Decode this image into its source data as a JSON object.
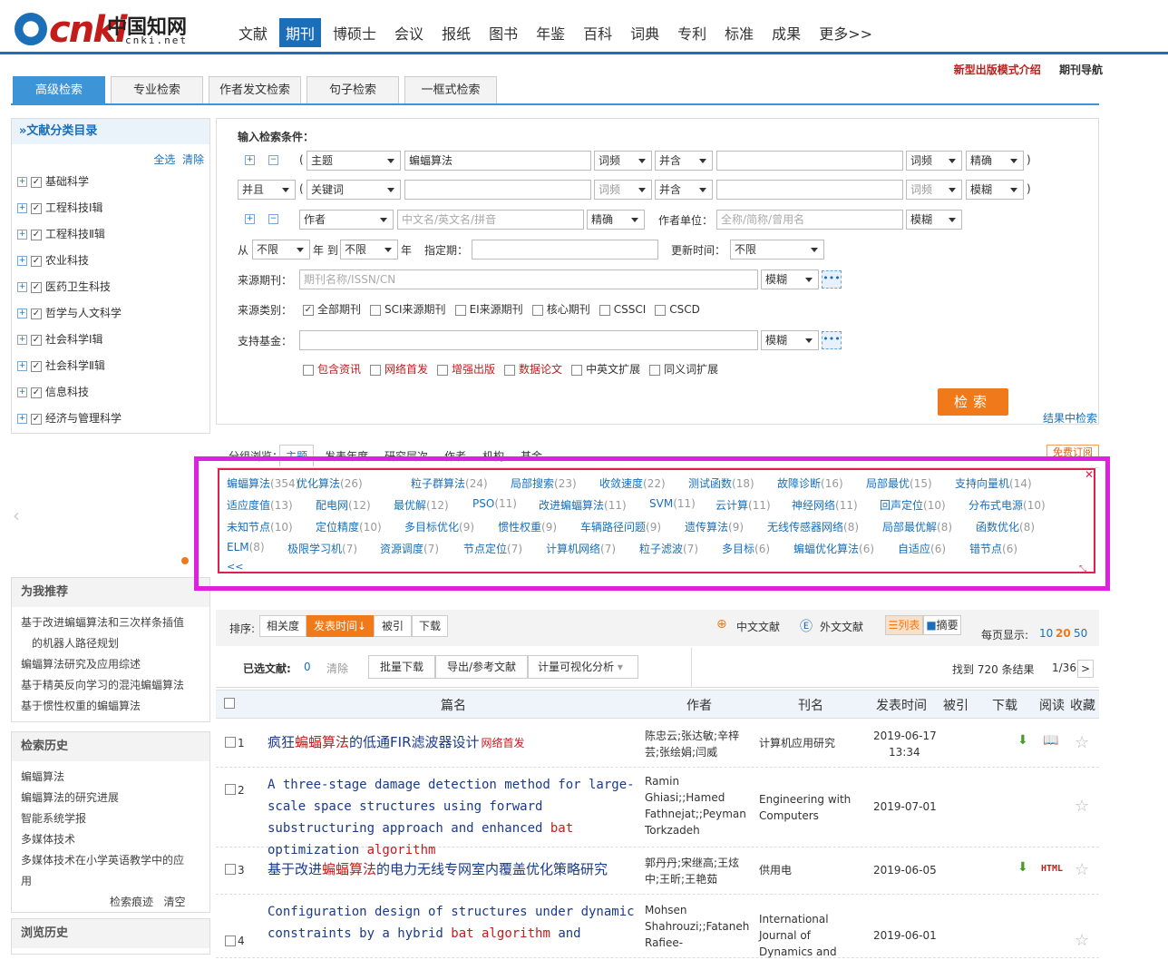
{
  "header": {
    "logo_text": "cnki",
    "logo_cn": "中国知网",
    "logo_url": "cnki.net",
    "nav": [
      "文献",
      "期刊",
      "博硕士",
      "会议",
      "报纸",
      "图书",
      "年鉴",
      "百科",
      "词典",
      "专利",
      "标准",
      "成果",
      "更多>>"
    ],
    "links": {
      "new_model": "新型出版模式介绍",
      "journal_nav": "期刊导航"
    }
  },
  "tabs": [
    "高级检索",
    "专业检索",
    "作者发文检索",
    "句子检索",
    "一框式检索"
  ],
  "sidebar": {
    "title": "»文献分类目录",
    "select_all": "全选",
    "clear": "清除",
    "categories": [
      "基础科学",
      "工程科技Ⅰ辑",
      "工程科技Ⅱ辑",
      "农业科技",
      "医药卫生科技",
      "哲学与人文科学",
      "社会科学Ⅰ辑",
      "社会科学Ⅱ辑",
      "信息科技",
      "经济与管理科学"
    ],
    "recommend_title": "为我推荐",
    "recommend": [
      "基于改进蝙蝠算法和三次样条插值",
      "的机器人路径规划",
      "蝙蝠算法研究及应用综述",
      "基于精英反向学习的混沌蝙蝠算法",
      "基于惯性权重的蝙蝠算法"
    ],
    "history_title": "检索历史",
    "history": [
      "蝙蝠算法",
      "蝙蝠算法的研究进展",
      "智能系统学报",
      "多媒体技术",
      "多媒体技术在小学英语教学中的应",
      "用"
    ],
    "history_ops": [
      "检索痕迹",
      "清空"
    ],
    "browse_title": "浏览历史"
  },
  "form": {
    "label": "输入检索条件：",
    "paren_open": "(",
    "paren_close": ")",
    "row1": {
      "field": "主题",
      "value": "蝙蝠算法",
      "freq": "词频",
      "rel": "并含",
      "freq2": "词频",
      "match": "精确"
    },
    "row2": {
      "logic": "并且",
      "field": "关键词",
      "freq": "词频",
      "rel": "并含",
      "freq2": "词频",
      "match": "模糊"
    },
    "row3": {
      "field": "作者",
      "placeholder": "中文名/英文名/拼音",
      "match": "精确",
      "unit_label": "作者单位：",
      "unit_placeholder": "全称/简称/曾用名",
      "unit_match": "模糊"
    },
    "row4": {
      "from": "从",
      "from_val": "不限",
      "year_to": "年 到",
      "to_val": "不限",
      "year": "年",
      "period": "指定期：",
      "update": "更新时间：",
      "update_val": "不限"
    },
    "source": {
      "label": "来源期刊：",
      "placeholder": "期刊名称/ISSN/CN",
      "match": "模糊"
    },
    "category": {
      "label": "来源类别：",
      "options": [
        "全部期刊",
        "SCI来源期刊",
        "EI来源期刊",
        "核心期刊",
        "CSSCI",
        "CSCD"
      ]
    },
    "fund": {
      "label": "支持基金：",
      "match": "模糊"
    },
    "extras": [
      "包含资讯",
      "网络首发",
      "增强出版",
      "数据论文",
      "中英文扩展",
      "同义词扩展"
    ],
    "search": "检索",
    "in_result": "结果中检索"
  },
  "group": {
    "label": "分组浏览：",
    "tabs": [
      "主题",
      "发表年度",
      "研究层次",
      "作者",
      "机构",
      "基金"
    ],
    "free_sub": "免费订阅",
    "terms": [
      [
        "蝙蝠算法",
        "(354)"
      ],
      [
        "优化算法",
        "(26)"
      ],
      [
        "粒子群算法",
        "(24)"
      ],
      [
        "局部搜索",
        "(23)"
      ],
      [
        "收敛速度",
        "(22)"
      ],
      [
        "测试函数",
        "(18)"
      ],
      [
        "故障诊断",
        "(16)"
      ],
      [
        "局部最优",
        "(15)"
      ],
      [
        "支持向量机",
        "(14)"
      ],
      [
        "适应度值",
        "(13)"
      ],
      [
        "配电网",
        "(12)"
      ],
      [
        "最优解",
        "(12)"
      ],
      [
        "PSO",
        "(11)"
      ],
      [
        "改进蝙蝠算法",
        "(11)"
      ],
      [
        "SVM",
        "(11)"
      ],
      [
        "云计算",
        "(11)"
      ],
      [
        "神经网络",
        "(11)"
      ],
      [
        "回声定位",
        "(10)"
      ],
      [
        "分布式电源",
        "(10)"
      ],
      [
        "未知节点",
        "(10)"
      ],
      [
        "定位精度",
        "(10)"
      ],
      [
        "多目标优化",
        "(9)"
      ],
      [
        "惯性权重",
        "(9)"
      ],
      [
        "车辆路径问题",
        "(9)"
      ],
      [
        "遗传算法",
        "(9)"
      ],
      [
        "无线传感器网络",
        "(8)"
      ],
      [
        "局部最优解",
        "(8)"
      ],
      [
        "函数优化",
        "(8)"
      ],
      [
        "ELM",
        "(8)"
      ],
      [
        "极限学习机",
        "(7)"
      ],
      [
        "资源调度",
        "(7)"
      ],
      [
        "节点定位",
        "(7)"
      ],
      [
        "计算机网络",
        "(7)"
      ],
      [
        "粒子滤波",
        "(7)"
      ],
      [
        "多目标",
        "(6)"
      ],
      [
        "蝙蝠优化算法",
        "(6)"
      ],
      [
        "自适应",
        "(6)"
      ],
      [
        "错节点",
        "(6)"
      ]
    ],
    "collapse": "<<"
  },
  "results": {
    "sort_label": "排序:",
    "sorts": [
      "相关度",
      "发表时间↓",
      "被引",
      "下载"
    ],
    "zh": "中文文献",
    "en": "外文文献",
    "list": "列表",
    "abstract": "摘要",
    "per_page_label": "每页显示:",
    "per_page": [
      "10",
      "20",
      "50"
    ],
    "selected_label": "已选文献:",
    "selected_count": "0",
    "clear": "清除",
    "batch": "批量下载",
    "export": "导出/参考文献",
    "visual": "计量可视化分析",
    "found": "找到 720 条结果",
    "page": "1/36",
    "next": ">",
    "columns": [
      "篇名",
      "作者",
      "刊名",
      "发表时间",
      "被引",
      "下载",
      "阅读",
      "收藏"
    ],
    "rows": [
      {
        "n": "1",
        "title": [
          [
            "疯狂",
            ""
          ],
          [
            "蝙蝠算法",
            "hl"
          ],
          [
            "的低通FIR滤波器设计",
            ""
          ]
        ],
        "tag": "网络首发",
        "authors": "陈忠云;张达敏;辛梓芸;张绘娟;闫威",
        "journal": "计算机应用研究",
        "date": "2019-06-17",
        "time": "13:34"
      },
      {
        "n": "2",
        "title": [
          [
            "A three-stage damage detection method for large-scale space structures using forward substructuring approach and enhanced ",
            ""
          ],
          [
            "bat",
            "hl"
          ],
          [
            " optimization ",
            ""
          ],
          [
            "algorithm",
            "hl"
          ]
        ],
        "authors": "Ramin Ghiasi;;Hamed Fathnejat;;Peyman Torkzadeh",
        "journal": "Engineering with Computers",
        "date": "2019-07-01"
      },
      {
        "n": "3",
        "title": [
          [
            "基于改进",
            ""
          ],
          [
            "蝙蝠算法",
            "hl"
          ],
          [
            "的电力无线专网室内覆盖优化策略研究",
            ""
          ]
        ],
        "authors": "郭丹丹;宋继高;王炫中;王昕;王艳茹",
        "journal": "供用电",
        "date": "2019-06-05",
        "html": "HTML"
      },
      {
        "n": "4",
        "title": [
          [
            "Configuration design of structures under dynamic constraints by a hybrid ",
            ""
          ],
          [
            "bat",
            "hl"
          ],
          [
            " ",
            ""
          ],
          [
            "algorithm",
            "hl"
          ],
          [
            " and",
            ""
          ]
        ],
        "authors": "Mohsen Shahrouzi;;Fataneh Rafiee-",
        "journal": "International Journal of Dynamics and",
        "date": "2019-06-01"
      }
    ]
  }
}
